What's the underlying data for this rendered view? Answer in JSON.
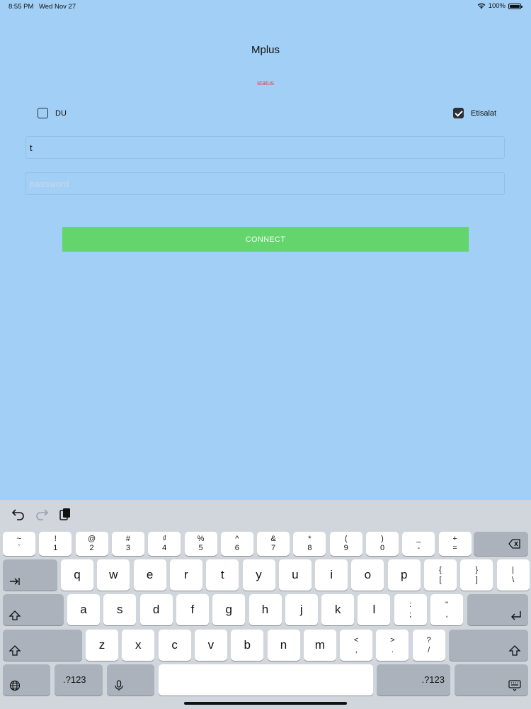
{
  "status_bar": {
    "time": "8:55 PM",
    "date": "Wed Nov 27",
    "battery": "100%",
    "battery_level": 1.0
  },
  "app": {
    "title": "Mplus",
    "status": "status"
  },
  "options": [
    {
      "label": "DU",
      "checked": false
    },
    {
      "label": "Etisalat",
      "checked": true
    }
  ],
  "username": {
    "value": "t",
    "placeholder": ""
  },
  "password": {
    "value": "",
    "placeholder": "password"
  },
  "connect_label": "CONNECT",
  "keyboard": {
    "toolbar": [
      "undo-icon",
      "redo-icon",
      "paste-icon"
    ],
    "number_row": [
      {
        "top": "~",
        "bottom": "`"
      },
      {
        "top": "!",
        "bottom": "1"
      },
      {
        "top": "@",
        "bottom": "2"
      },
      {
        "top": "#",
        "bottom": "3"
      },
      {
        "top": "₫",
        "bottom": "4"
      },
      {
        "top": "%",
        "bottom": "5"
      },
      {
        "top": "^",
        "bottom": "6"
      },
      {
        "top": "&",
        "bottom": "7"
      },
      {
        "top": "*",
        "bottom": "8"
      },
      {
        "top": "(",
        "bottom": "9"
      },
      {
        "top": ")",
        "bottom": "0"
      },
      {
        "top": "_",
        "bottom": "-"
      },
      {
        "top": "+",
        "bottom": "="
      }
    ],
    "row1": [
      "q",
      "w",
      "e",
      "r",
      "t",
      "y",
      "u",
      "i",
      "o",
      "p"
    ],
    "row1_extra": [
      {
        "top": "{",
        "bottom": "["
      },
      {
        "top": "}",
        "bottom": "]"
      },
      {
        "top": "|",
        "bottom": "\\"
      }
    ],
    "row2": [
      "a",
      "s",
      "d",
      "f",
      "g",
      "h",
      "j",
      "k",
      "l"
    ],
    "row2_extra": [
      {
        "top": ":",
        "bottom": ";"
      },
      {
        "top": "\"",
        "bottom": ","
      }
    ],
    "row3": [
      "z",
      "x",
      "c",
      "v",
      "b",
      "n",
      "m"
    ],
    "row3_extra": [
      {
        "top": "<",
        "bottom": ","
      },
      {
        "top": ">",
        "bottom": "."
      },
      {
        "top": "?",
        "bottom": "/"
      }
    ],
    "numbers_label": ".?123"
  }
}
